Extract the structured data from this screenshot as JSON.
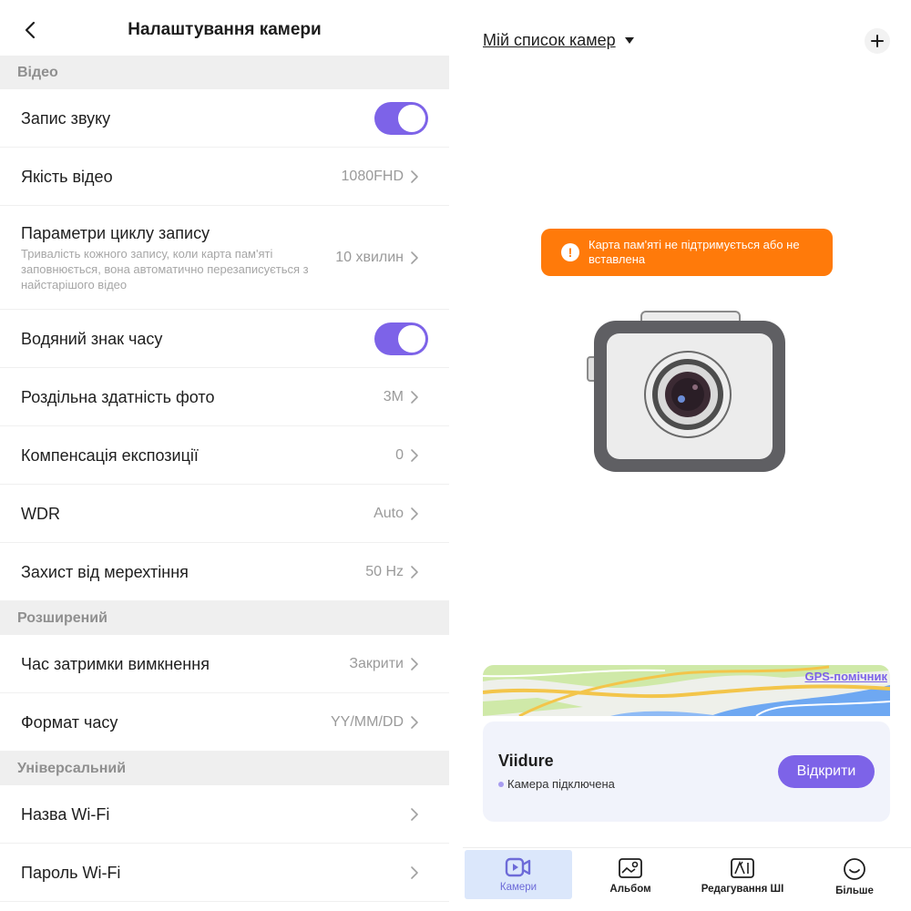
{
  "settings": {
    "title": "Налаштування камери",
    "sections": {
      "video": "Відео",
      "extended": "Розширений",
      "universal": "Універсальний"
    },
    "rows": {
      "sound_recording": {
        "label": "Запис звуку",
        "toggle_on": true
      },
      "video_quality": {
        "label": "Якість відео",
        "value": "1080FHD"
      },
      "loop_recording": {
        "label": "Параметри циклу запису",
        "description": "Тривалість кожного запису, коли карта пам'яті заповнюється, вона автоматично перезаписується з найстарішого відео",
        "value": "10 хвилин"
      },
      "time_watermark": {
        "label": "Водяний знак часу",
        "toggle_on": true
      },
      "photo_resolution": {
        "label": "Роздільна здатність фото",
        "value": "3M"
      },
      "exposure": {
        "label": "Компенсація експозиції",
        "value": "0"
      },
      "wdr": {
        "label": "WDR",
        "value": "Auto"
      },
      "flicker": {
        "label": "Захист від мерехтіння",
        "value": "50 Hz"
      },
      "shutdown_delay": {
        "label": "Час затримки вимкнення",
        "value": "Закрити"
      },
      "time_format": {
        "label": "Формат часу",
        "value": "YY/MM/DD"
      },
      "wifi_name": {
        "label": "Назва Wi-Fi"
      },
      "wifi_password": {
        "label": "Пароль Wi-Fi"
      }
    }
  },
  "cameras": {
    "list_label": "Мій список камер",
    "alert": "Карта пам'яті не підтримується або не вставлена",
    "gps_link": "GPS-помічник",
    "device": {
      "name": "Viidure",
      "status": "Камера підключена",
      "open_label": "Відкрити"
    }
  },
  "tabs": [
    {
      "label": "Камери",
      "icon": "video-camera-icon",
      "active": true
    },
    {
      "label": "Альбом",
      "icon": "album-icon",
      "active": false
    },
    {
      "label": "Редагування ШІ",
      "icon": "ai-edit-icon",
      "active": false
    },
    {
      "label": "Більше",
      "icon": "smile-icon",
      "active": false
    }
  ],
  "colors": {
    "accent": "#7d63e8",
    "alert": "#ff7a0a",
    "section_bg": "#efefef",
    "card_bg": "#f1f3fb"
  }
}
